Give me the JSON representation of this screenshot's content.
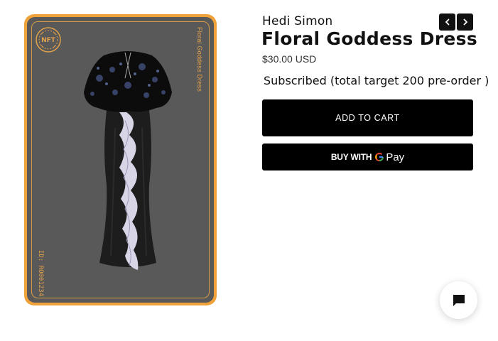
{
  "card": {
    "badge_text": "NFT",
    "vertical_title": "Floral Goddess Dress",
    "vertical_id": "ID: RO001234"
  },
  "product": {
    "vendor": "Hedi Simon",
    "title": "Floral Goddess Dress",
    "price": "$30.00 USD",
    "subscription_note": "Subscribed (total target 200 pre-order )"
  },
  "nav": {
    "prev_icon": "chevron-left-icon",
    "next_icon": "chevron-right-icon"
  },
  "actions": {
    "add_to_cart_label": "ADD TO CART",
    "buy_with_label": "BUY WITH",
    "pay_label": "Pay"
  },
  "chat": {
    "icon": "chat-bubble-icon"
  },
  "colors": {
    "card_border": "#f0a23a",
    "card_background": "#595959",
    "card_accent": "#e4a24a",
    "button_background": "#000000",
    "button_text": "#ffffff"
  }
}
